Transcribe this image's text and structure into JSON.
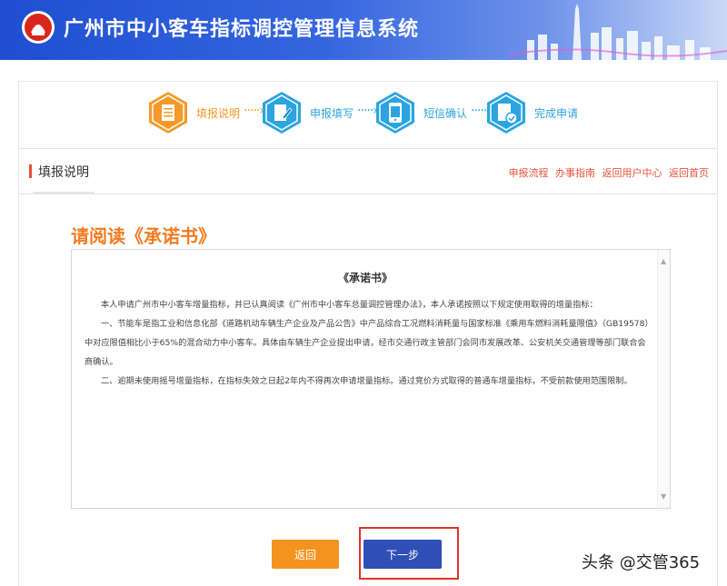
{
  "header": {
    "title": "广州市中小客车指标调控管理信息系统"
  },
  "steps": [
    {
      "label": "填报说明",
      "icon": "document-icon",
      "color": "#f39a2b",
      "active": true
    },
    {
      "label": "申报填写",
      "icon": "edit-icon",
      "color": "#2ba4e0",
      "active": false
    },
    {
      "label": "短信确认",
      "icon": "phone-icon",
      "color": "#2ba4e0",
      "active": false
    },
    {
      "label": "完成申请",
      "icon": "check-document-icon",
      "color": "#2ba4e0",
      "active": false
    }
  ],
  "section": {
    "title": "填报说明",
    "links": [
      "申报流程",
      "办事指南",
      "返回用户中心",
      "返回首页"
    ]
  },
  "read_title": "请阅读《承诺书》",
  "pledge": {
    "heading": "《承诺书》",
    "paragraphs": [
      "本人申请广州市中小客车增量指标，并已认真阅读《广州市中小客车总量调控管理办法》，本人承诺按照以下规定使用取得的增量指标：",
      "一、节能车是指工业和信息化部《道路机动车辆生产企业及产品公告》中产品综合工况燃料消耗量与国家标准《乘用车燃料消耗量限值》（GB19578）中对应限值相比小于65%的混合动力中小客车。具体由车辆生产企业提出申请，经市交通行政主管部门会同市发展改革、公安机关交通管理等部门联合会商确认。",
      "二、逾期未使用摇号增量指标，在指标失效之日起2年内不得再次申请增量指标。通过竞价方式取得的普通车增量指标，不受前款使用范围限制。"
    ]
  },
  "buttons": {
    "back": "返回",
    "next": "下一步"
  },
  "watermark": "头条 @交管365",
  "colors": {
    "accent_orange": "#f37c22",
    "accent_red": "#e5523a",
    "primary_blue": "#2d4fb6"
  }
}
